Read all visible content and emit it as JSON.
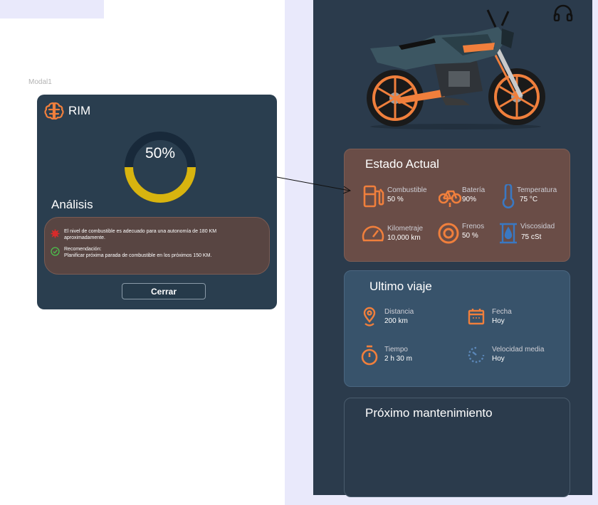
{
  "frame_label": "Modal1",
  "modal": {
    "title": "RIM",
    "gauge_value": "50%",
    "gauge_fraction": 0.5,
    "analysis_heading": "Análisis",
    "messages": [
      {
        "icon": "alert-icon",
        "text": "El nivel de combustible es adecuado para una autonomía de 180 KM\naproximadamente."
      },
      {
        "icon": "check-circle-icon",
        "text": "Recomendación:\nPlanificar próxima parada de combustible en los próximos 150 KM."
      }
    ],
    "close_label": "Cerrar"
  },
  "estado": {
    "title": "Estado Actual",
    "items": [
      {
        "icon": "fuel-pump-icon",
        "label": "Combustible",
        "value": "50 %"
      },
      {
        "icon": "bicycle-icon",
        "label": "Batería",
        "value": "90%"
      },
      {
        "icon": "thermometer-icon",
        "label": "Temperatura",
        "value": "75 °C"
      },
      {
        "icon": "speedometer-icon",
        "label": "Kilometraje",
        "value": "10,000 km"
      },
      {
        "icon": "brake-disc-icon",
        "label": "Frenos",
        "value": "50 %"
      },
      {
        "icon": "viscosity-icon",
        "label": "Viscosidad",
        "value": "75 cSt"
      }
    ]
  },
  "viaje": {
    "title": "Ultimo viaje",
    "items": [
      {
        "icon": "location-pin-icon",
        "label": "Distancia",
        "value": "200 km"
      },
      {
        "icon": "calendar-icon",
        "label": "Fecha",
        "value": "Hoy"
      },
      {
        "icon": "stopwatch-icon",
        "label": "Tiempo",
        "value": "2 h 30 m"
      },
      {
        "icon": "speed-gauge-icon",
        "label": "Velocidad media",
        "value": "Hoy"
      }
    ]
  },
  "mantenimiento": {
    "title": "Próximo mantenimiento"
  },
  "colors": {
    "accent_orange": "#f07f3c",
    "gauge_yellow": "#d8b40f",
    "card_brown": "#6a4d47",
    "card_blue": "#38536b",
    "phone_bg": "#2b3b4c"
  }
}
